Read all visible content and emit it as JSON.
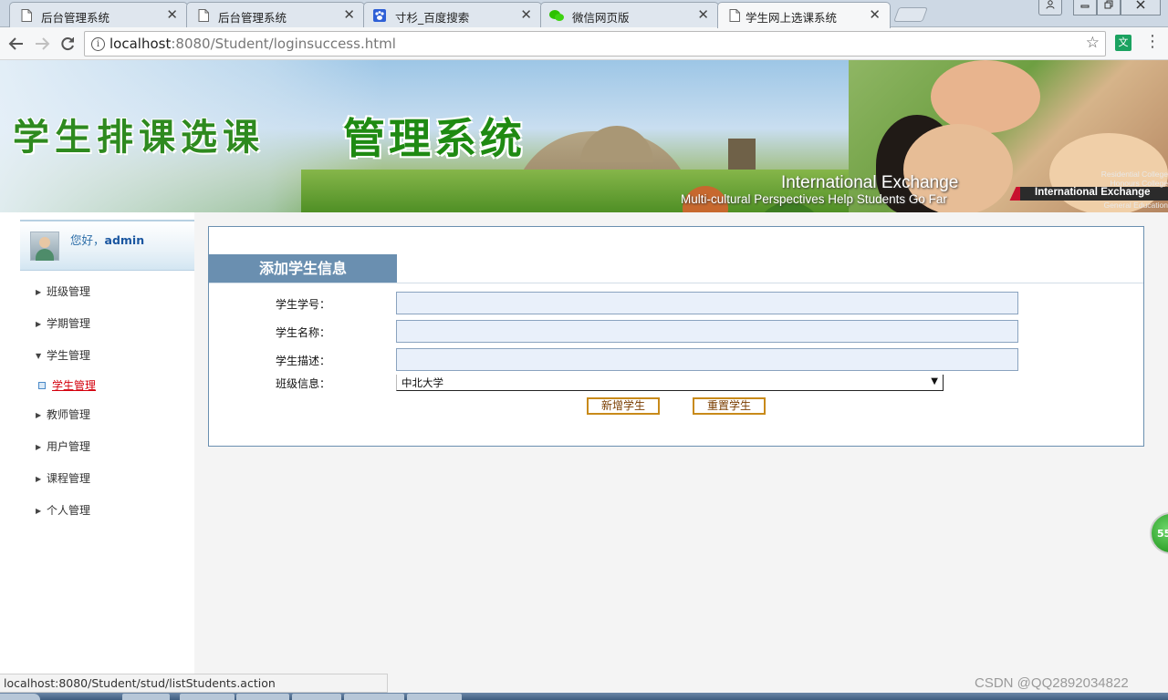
{
  "browser": {
    "tabs": [
      {
        "title": "后台管理系统",
        "icon": "page-icon",
        "active": false
      },
      {
        "title": "后台管理系统",
        "icon": "page-icon",
        "active": false
      },
      {
        "title": "寸杉_百度搜索",
        "icon": "baidu-paw-icon",
        "active": false
      },
      {
        "title": "微信网页版",
        "icon": "wechat-icon",
        "active": false
      },
      {
        "title": "学生网上选课系统",
        "icon": "page-icon",
        "active": true
      }
    ],
    "close_glyph": "✕",
    "url_host": "localhost",
    "url_rest": ":8080/Student/loginsuccess.html",
    "translate_label": "文"
  },
  "banner": {
    "title_part1": "学生排课选课",
    "title_part2": "管理系统",
    "intl_heading": "International Exchange",
    "tagline": "Multi-cultural Perspectives Help Students Go Far",
    "badge": "International Exchange",
    "side_lines": [
      "Residential College",
      "Honours College",
      "General Education"
    ]
  },
  "sidebar": {
    "greeting_prefix": "您好，",
    "username": "admin",
    "menu": [
      {
        "label": "班级管理",
        "expanded": false
      },
      {
        "label": "学期管理",
        "expanded": false
      },
      {
        "label": "学生管理",
        "expanded": true,
        "children": [
          {
            "label": "学生管理",
            "active": true
          }
        ]
      },
      {
        "label": "教师管理",
        "expanded": false
      },
      {
        "label": "用户管理",
        "expanded": false
      },
      {
        "label": "课程管理",
        "expanded": false
      },
      {
        "label": "个人管理",
        "expanded": false
      }
    ]
  },
  "form": {
    "title": "添加学生信息",
    "fields": [
      {
        "label": "学生学号：",
        "value": ""
      },
      {
        "label": "学生名称：",
        "value": ""
      },
      {
        "label": "学生描述：",
        "value": ""
      }
    ],
    "class_label": "班级信息：",
    "class_selected": "中北大学",
    "submit_label": "新增学生",
    "reset_label": "重置学生"
  },
  "status_url": "localhost:8080/Student/stud/listStudents.action",
  "watermark": "CSDN @QQ2892034822",
  "floater_text": "55",
  "colors": {
    "panel_header": "#6a8fb0",
    "field_bg": "#e9f0fa",
    "button_border": "#c88a1a",
    "active_link": "#d4000d",
    "greeting": "#2d6ea8"
  }
}
